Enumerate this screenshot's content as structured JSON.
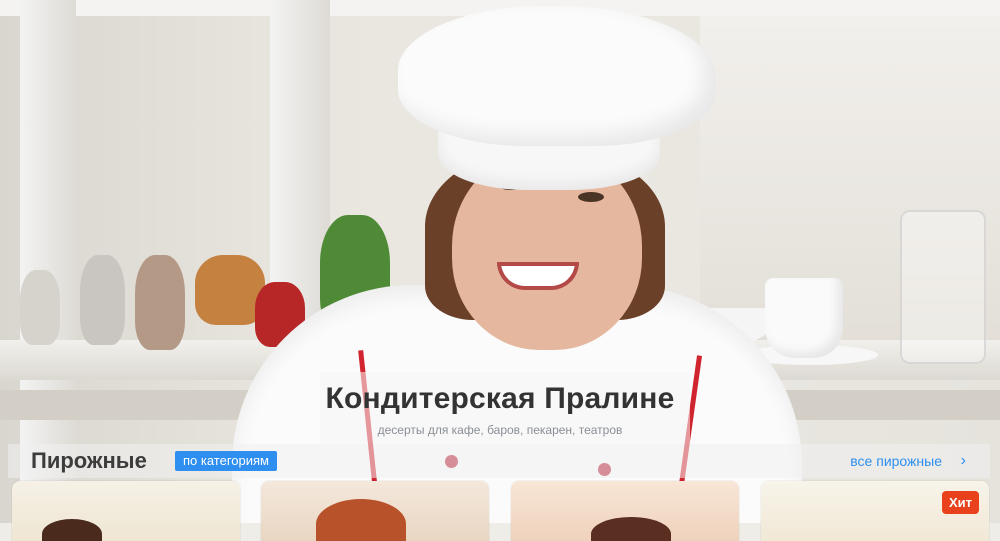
{
  "hero": {
    "title": "Кондитерская Пралине",
    "subtitle": "десерты для кафе, баров, пекарен, театров"
  },
  "section": {
    "title": "Пирожные",
    "category_badge": "по категориям",
    "all_link": "все пирожные",
    "all_icon": "chevron-right-icon"
  },
  "cards": [
    {
      "badge": ""
    },
    {
      "badge": ""
    },
    {
      "badge": ""
    },
    {
      "badge": "Хит"
    }
  ],
  "colors": {
    "accent": "#2e8ff0",
    "hit_badge": "#e8411c",
    "title_text": "#333333"
  }
}
